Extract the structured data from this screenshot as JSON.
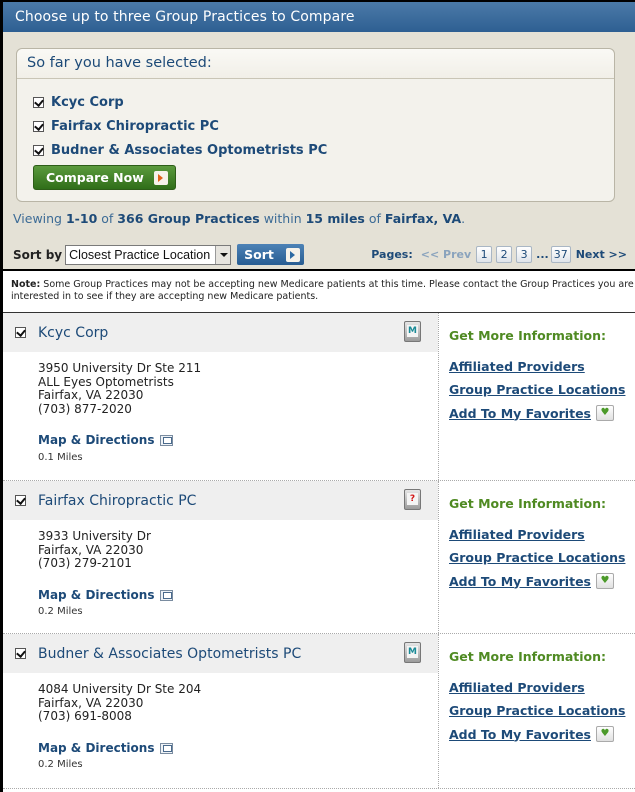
{
  "title": "Choose up to three Group Practices to Compare",
  "selected_box": {
    "title": "So far you have selected:",
    "items": [
      {
        "label": "Kcyc Corp",
        "checked": true
      },
      {
        "label": "Fairfax Chiropractic PC",
        "checked": true
      },
      {
        "label": "Budner & Associates Optometrists PC",
        "checked": true
      }
    ],
    "compare_button": "Compare Now"
  },
  "viewing": {
    "prefix": "Viewing",
    "range": "1-10",
    "of": "of",
    "total": "366 Group Practices",
    "within": "within",
    "distance": "15 miles",
    "of2": "of",
    "location": "Fairfax, VA",
    "suffix": "."
  },
  "sort": {
    "label": "Sort by",
    "selected_option": "Closest Practice Location",
    "button": "Sort"
  },
  "pager": {
    "label": "Pages:",
    "prev": "<< Prev",
    "pages": [
      "1",
      "2",
      "3"
    ],
    "ellipsis": "...",
    "last": "37",
    "next": "Next >>"
  },
  "note": {
    "label": "Note:",
    "text": " Some Group Practices may not be accepting new Medicare patients at this time. Please contact the Group Practices you are interested in to see if they are accepting new Medicare patients."
  },
  "results": [
    {
      "name": "Kcyc Corp",
      "checked": true,
      "medicare_icon": "medicare-accepting-icon",
      "address_lines": [
        "3950 University Dr Ste 211",
        "ALL Eyes Optometrists",
        "Fairfax, VA 22030",
        "(703) 877-2020"
      ],
      "map_link": "Map & Directions",
      "distance": "0.1 Miles",
      "more_title": "Get More Information:",
      "links": {
        "affiliated": "Affiliated Providers",
        "locations": "Group Practice Locations",
        "favorites": "Add To My Favorites"
      }
    },
    {
      "name": "Fairfax Chiropractic PC",
      "checked": true,
      "medicare_icon": "medicare-unknown-icon",
      "address_lines": [
        "3933 University Dr",
        "Fairfax, VA 22030",
        "(703) 279-2101"
      ],
      "map_link": "Map & Directions",
      "distance": "0.2 Miles",
      "more_title": "Get More Information:",
      "links": {
        "affiliated": "Affiliated Providers",
        "locations": "Group Practice Locations",
        "favorites": "Add To My Favorites"
      }
    },
    {
      "name": "Budner & Associates Optometrists PC",
      "checked": true,
      "medicare_icon": "medicare-accepting-icon",
      "address_lines": [
        "4084 University Dr Ste 204",
        "Fairfax, VA 22030",
        "(703) 691-8008"
      ],
      "map_link": "Map & Directions",
      "distance": "0.2 Miles",
      "more_title": "Get More Information:",
      "links": {
        "affiliated": "Affiliated Providers",
        "locations": "Group Practice Locations",
        "favorites": "Add To My Favorites"
      }
    }
  ],
  "icon_glyphs": {
    "medicare_accepting": "M",
    "medicare_unknown": "?",
    "heart": "♥"
  },
  "colors": {
    "title_bar": "#3a6b9c",
    "link_blue": "#1d4a78",
    "green_button": "#3f7e26",
    "more_info_green": "#4f8a22"
  }
}
